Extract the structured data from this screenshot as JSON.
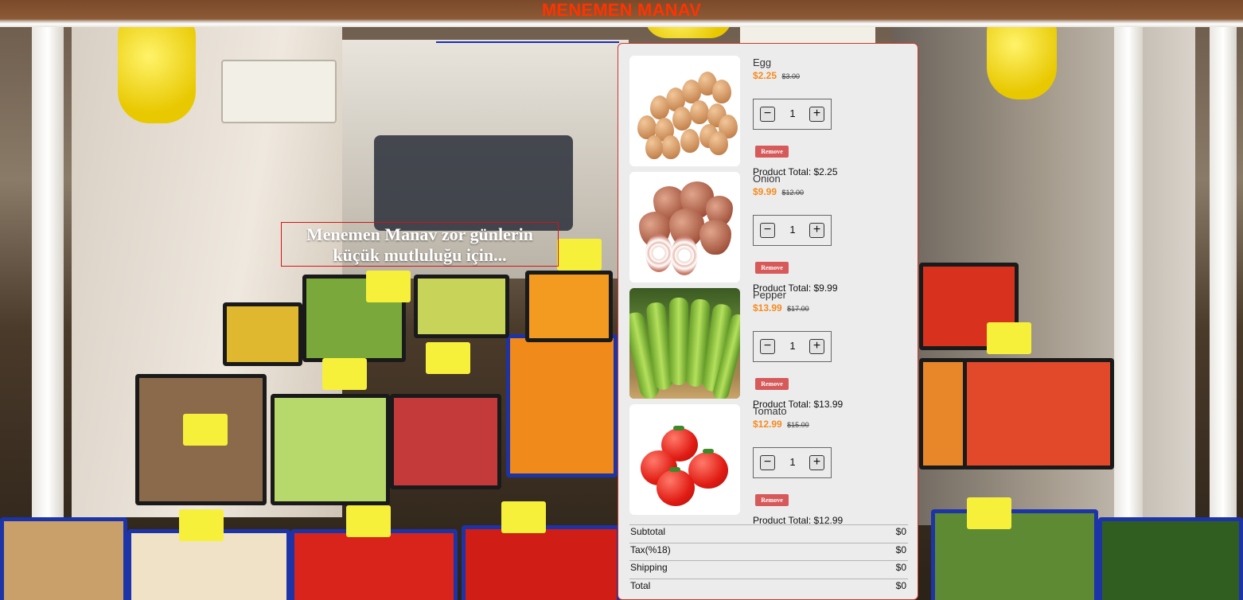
{
  "brand": {
    "title": "MENEMEN MANAV"
  },
  "slogan": {
    "line1": "Menemen Manav zor günlerin",
    "line2": "küçük mutluluğu için..."
  },
  "cart": {
    "items": [
      {
        "name": "Egg",
        "price": "$2.25",
        "old_price": "$3.00",
        "quantity": "1",
        "remove_label": "Remove",
        "total_label": "Product Total: $2.25",
        "image_icon": "eggs-image"
      },
      {
        "name": "Onion",
        "price": "$9.99",
        "old_price": "$12.00",
        "quantity": "1",
        "remove_label": "Remove",
        "total_label": "Product Total: $9.99",
        "image_icon": "onions-image"
      },
      {
        "name": "Pepper",
        "price": "$13.99",
        "old_price": "$17.00",
        "quantity": "1",
        "remove_label": "Remove",
        "total_label": "Product Total: $13.99",
        "image_icon": "peppers-image"
      },
      {
        "name": "Tomato",
        "price": "$12.99",
        "old_price": "$15.00",
        "quantity": "1",
        "remove_label": "Remove",
        "total_label": "Product Total: $12.99",
        "image_icon": "tomatoes-image"
      }
    ],
    "minus_symbol": "−",
    "plus_symbol": "+",
    "summary": [
      {
        "label": "Subtotal",
        "value": "$0"
      },
      {
        "label": "Tax(%18)",
        "value": "$0"
      },
      {
        "label": "Shipping",
        "value": "$0"
      },
      {
        "label": "Total",
        "value": "$0"
      }
    ]
  },
  "colors": {
    "brand": "#ff3300",
    "price": "#f58b1f",
    "remove": "#d65a5a",
    "cart_border": "#c83a2a",
    "accent_line": "#1a2fb3"
  }
}
